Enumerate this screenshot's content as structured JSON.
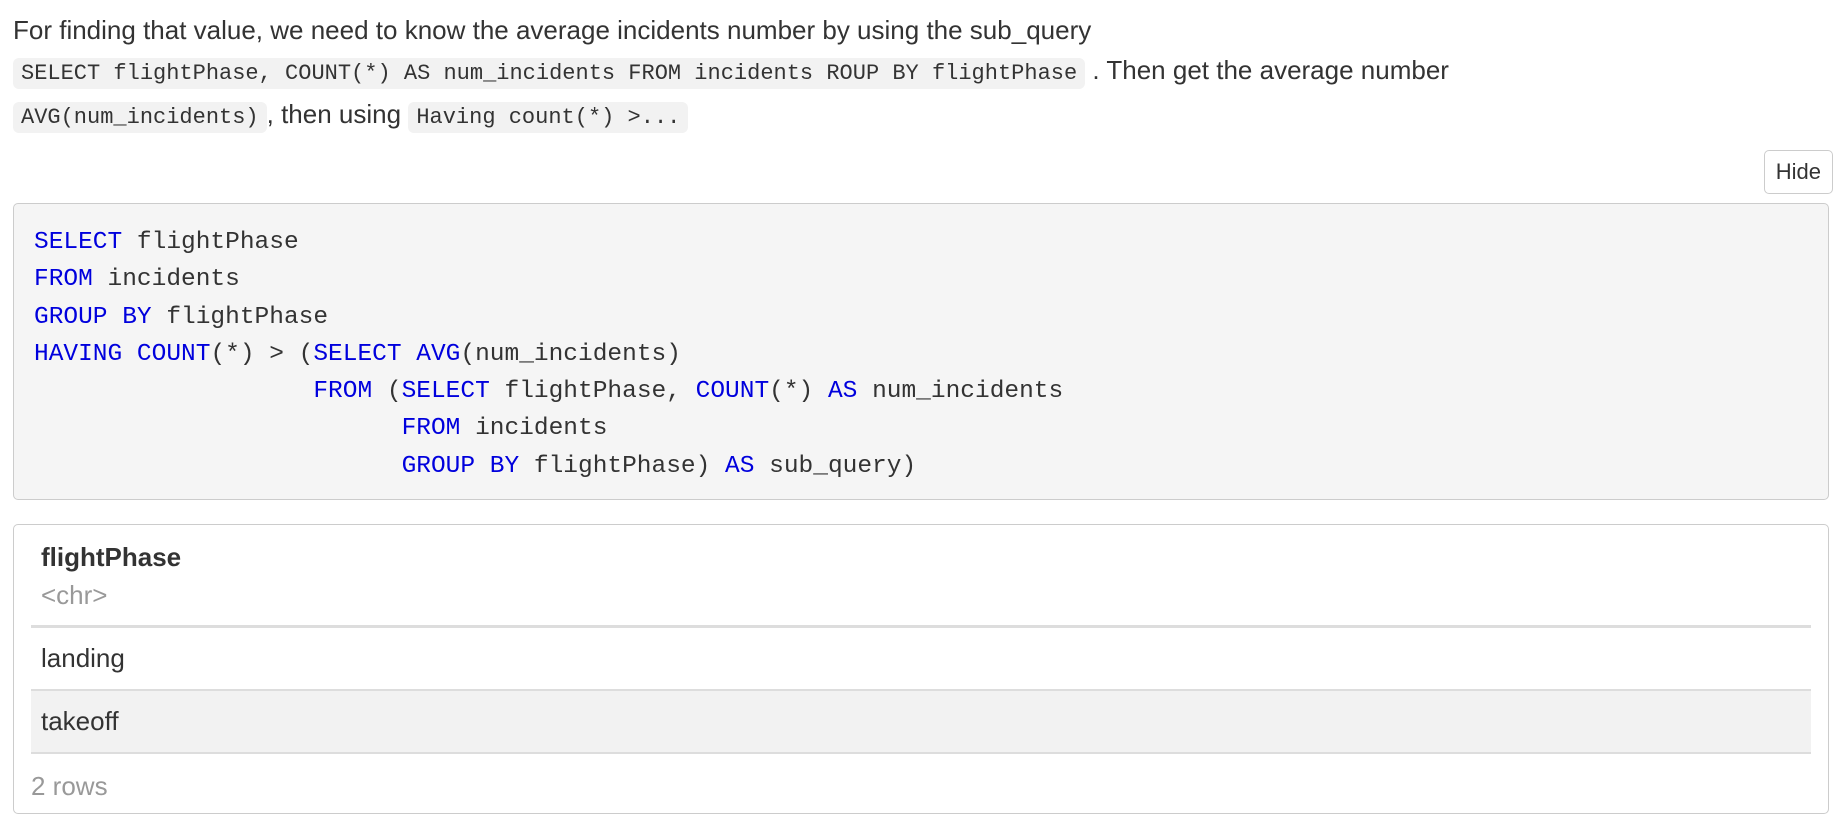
{
  "intro": {
    "line1": "For finding that value, we need to know the average incidents number by using the sub_query",
    "code1": "SELECT flightPhase, COUNT(*) AS num_incidents FROM incidents ROUP BY flightPhase",
    "text2": ". Then get the average number",
    "code2": "AVG(num_incidents)",
    "text3": ", then using",
    "code3": "Having count(*) >..."
  },
  "toggle": {
    "hide_label": "Hide"
  },
  "code": {
    "lines": [
      [
        {
          "kw": "SELECT"
        },
        {
          "t": " flightPhase"
        }
      ],
      [
        {
          "kw": "FROM"
        },
        {
          "t": " incidents"
        }
      ],
      [
        {
          "kw": "GROUP"
        },
        {
          "t": " "
        },
        {
          "kw": "BY"
        },
        {
          "t": " flightPhase"
        }
      ],
      [
        {
          "kw": "HAVING"
        },
        {
          "t": " "
        },
        {
          "kw": "COUNT"
        },
        {
          "t": "(*) > ("
        },
        {
          "kw": "SELECT"
        },
        {
          "t": " "
        },
        {
          "kw": "AVG"
        },
        {
          "t": "(num_incidents)"
        }
      ],
      [
        {
          "t": "                   "
        },
        {
          "kw": "FROM"
        },
        {
          "t": " ("
        },
        {
          "kw": "SELECT"
        },
        {
          "t": " flightPhase, "
        },
        {
          "kw": "COUNT"
        },
        {
          "t": "(*) "
        },
        {
          "kw": "AS"
        },
        {
          "t": " num_incidents"
        }
      ],
      [
        {
          "t": "                         "
        },
        {
          "kw": "FROM"
        },
        {
          "t": " incidents"
        }
      ],
      [
        {
          "t": "                         "
        },
        {
          "kw": "GROUP"
        },
        {
          "t": " "
        },
        {
          "kw": "BY"
        },
        {
          "t": " flightPhase) "
        },
        {
          "kw": "AS"
        },
        {
          "t": " sub_query)"
        }
      ]
    ]
  },
  "result_table": {
    "column_name": "flightPhase",
    "column_type": "<chr>",
    "rows": [
      "landing",
      "takeoff"
    ],
    "row_count": "2 rows"
  },
  "colors": {
    "keyword": "#0000dd",
    "text": "#333333",
    "muted": "#999999",
    "code_bg": "#f5f5f5"
  }
}
